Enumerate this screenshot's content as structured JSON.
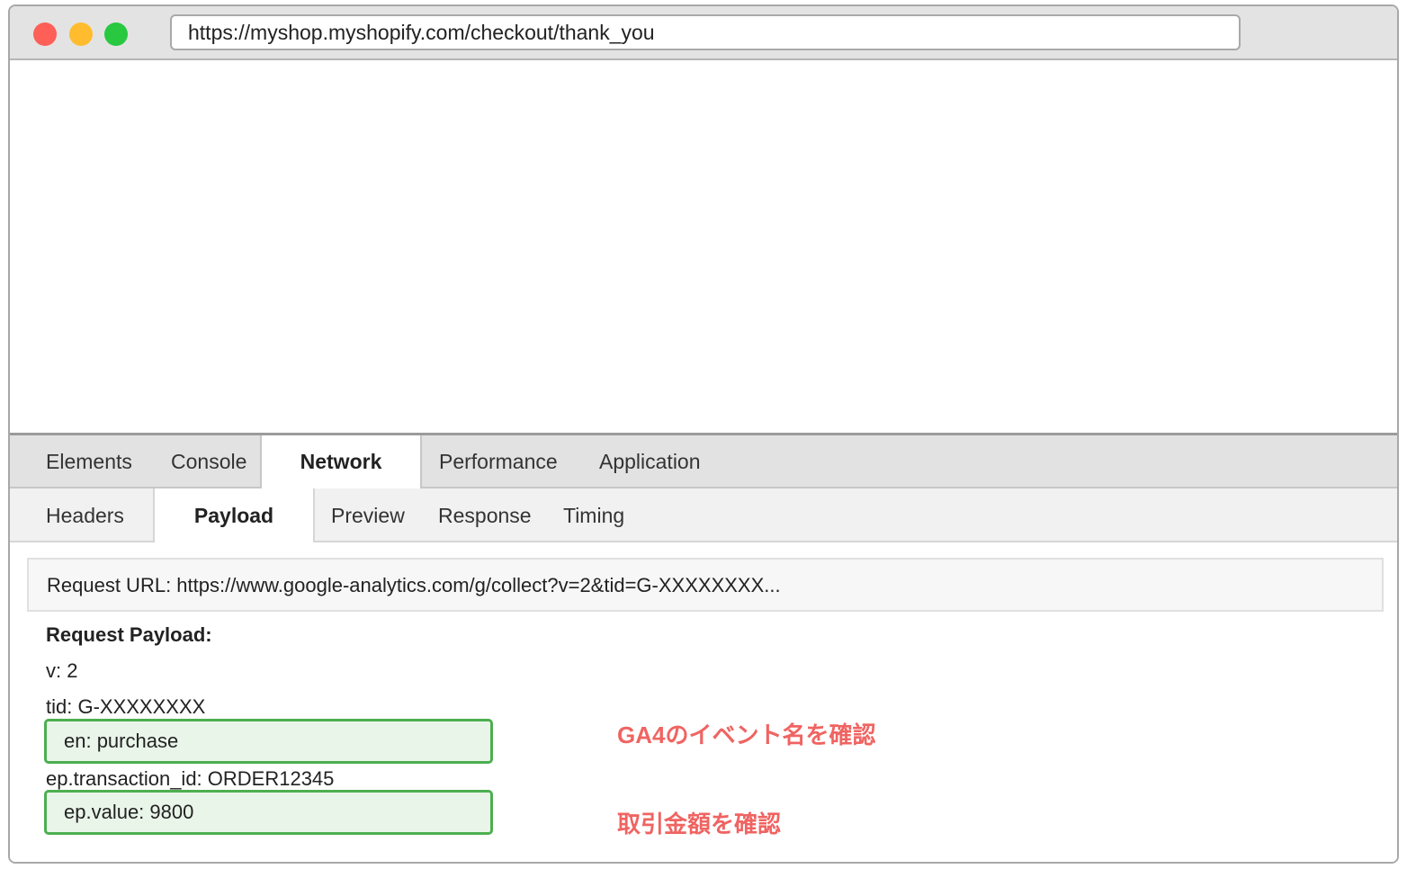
{
  "browser": {
    "url": "https://myshop.myshopify.com/checkout/thank_you"
  },
  "devtools": {
    "main_tabs": [
      "Elements",
      "Console",
      "Network",
      "Performance",
      "Application"
    ],
    "active_main_tab": "Network",
    "sub_tabs": [
      "Headers",
      "Payload",
      "Preview",
      "Response",
      "Timing"
    ],
    "active_sub_tab": "Payload",
    "request_url": "Request URL: https://www.google-analytics.com/g/collect?v=2&tid=G-XXXXXXXX...",
    "payload_title": "Request Payload:",
    "payload_lines": [
      "v: 2",
      "tid: G-XXXXXXXX",
      "en: purchase",
      "ep.transaction_id: ORDER12345",
      "ep.value: 9800"
    ]
  },
  "annotations": {
    "event_name": "GA4のイベント名を確認",
    "transaction_value": "取引金額を確認"
  },
  "colors": {
    "highlight_border": "#4caf50",
    "highlight_fill": "#e9f5e9",
    "annotation_text": "#ef6462",
    "traffic_red": "#fe5f57",
    "traffic_yellow": "#febc2e",
    "traffic_green": "#28c840"
  }
}
